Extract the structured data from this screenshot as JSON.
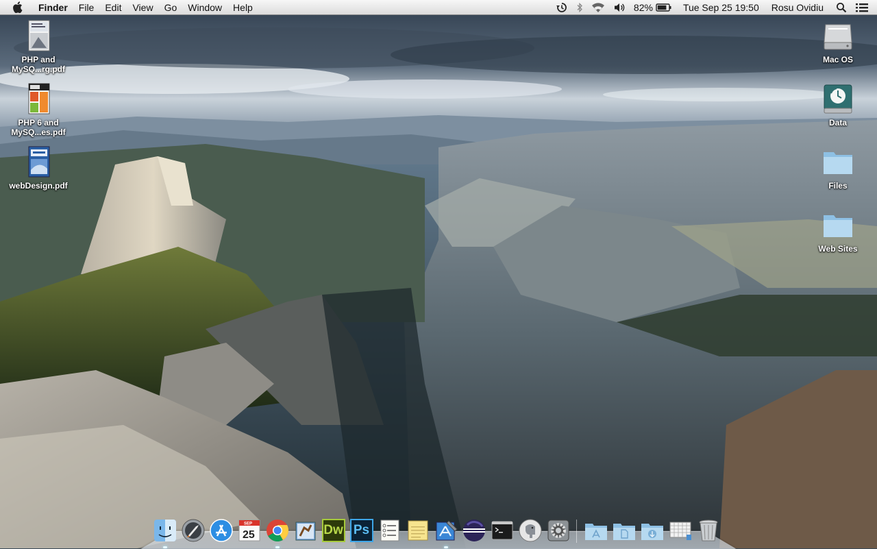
{
  "menubar": {
    "app_name": "Finder",
    "menus": [
      "File",
      "Edit",
      "View",
      "Go",
      "Window",
      "Help"
    ],
    "battery_percent": "82%",
    "battery_level": 0.82,
    "clock": "Tue Sep 25  19:50",
    "user": "Rosu Ovidiu",
    "icons": [
      "apple-icon",
      "time-machine-icon",
      "bluetooth-icon",
      "wifi-icon",
      "volume-icon",
      "battery-icon",
      "spotlight-icon",
      "notification-center-icon"
    ]
  },
  "desktop_left": [
    {
      "label": "PHP and MySQ...rg.pdf",
      "icon": "pdf-document-icon"
    },
    {
      "label": "PHP 6 and MySQ...es.pdf",
      "icon": "pdf-document-icon"
    },
    {
      "label": "webDesign.pdf",
      "icon": "pdf-document-icon"
    }
  ],
  "desktop_right": [
    {
      "label": "Mac OS",
      "icon": "hard-drive-icon"
    },
    {
      "label": "Data",
      "icon": "time-machine-drive-icon"
    },
    {
      "label": "Files",
      "icon": "folder-icon"
    },
    {
      "label": "Web Sites",
      "icon": "folder-icon"
    }
  ],
  "dock": {
    "calendar_month": "SEP",
    "calendar_day": "25",
    "dreamweaver_label": "Dw",
    "photoshop_label": "Ps",
    "apps": [
      "finder-icon",
      "launchpad-icon",
      "app-store-icon",
      "calendar-icon",
      "chrome-icon",
      "mail-icon",
      "dreamweaver-icon",
      "photoshop-icon",
      "reminders-icon",
      "notes-icon",
      "xcode-icon",
      "eclipse-icon",
      "terminal-icon",
      "sequel-pro-icon",
      "system-preferences-icon"
    ],
    "stacks": [
      "applications-stack-icon",
      "documents-stack-icon",
      "downloads-stack-icon",
      "display-stack-icon",
      "trash-icon"
    ]
  },
  "colors": {
    "menubar_bg": "#e9e9e9",
    "sky": "#5e7386",
    "folder_blue": "#a9cde8"
  }
}
